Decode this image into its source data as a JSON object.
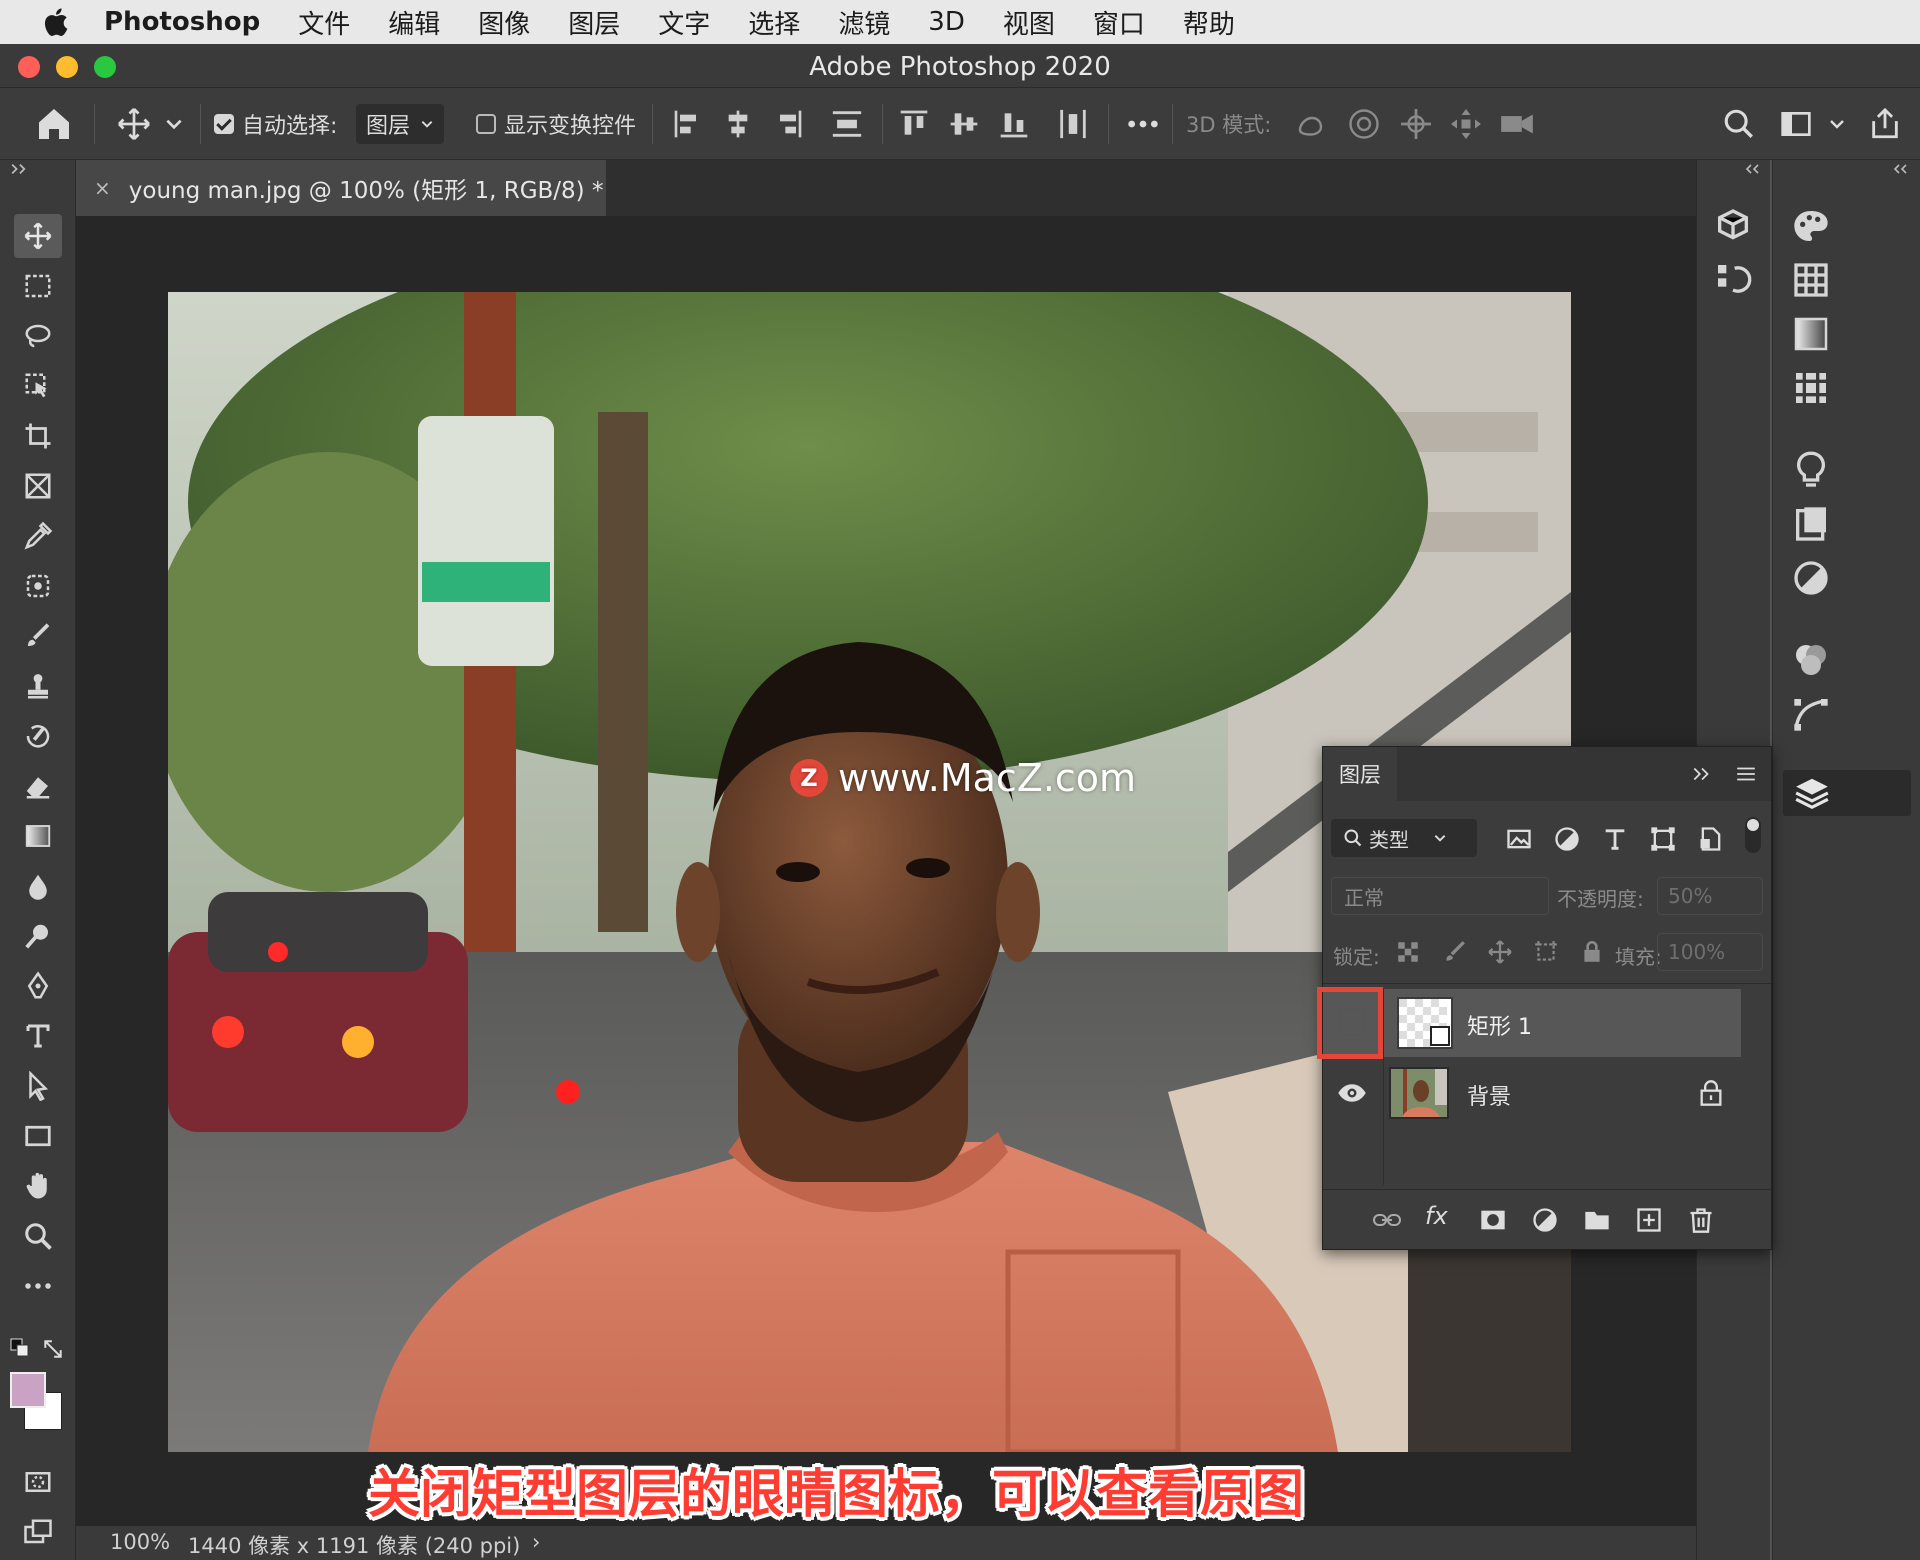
{
  "menubar": {
    "apple_icon": "apple-logo-icon",
    "app_name": "Photoshop",
    "items": [
      "文件",
      "编辑",
      "图像",
      "图层",
      "文字",
      "选择",
      "滤镜",
      "3D",
      "视图",
      "窗口",
      "帮助"
    ]
  },
  "window": {
    "title": "Adobe Photoshop 2020",
    "traffic_lights": {
      "close": "#ff5f57",
      "minimize": "#febc2e",
      "zoom": "#28c840"
    }
  },
  "options_bar": {
    "auto_select_label": "自动选择:",
    "auto_select_checked": true,
    "auto_select_target": "图层",
    "show_transform_label": "显示变换控件",
    "show_transform_checked": false,
    "mode_3d_label": "3D 模式:"
  },
  "document": {
    "tab_close": "×",
    "tab_title": "young man.jpg @ 100% (矩形 1, RGB/8) *",
    "watermark": "www.MacZ.com",
    "watermark_badge": "Z",
    "caption": "关闭矩型图层的眼睛图标，可以查看原图"
  },
  "status": {
    "zoom": "100%",
    "info": "1440 像素 x 1191 像素 (240 ppi)",
    "arrow": "›"
  },
  "colors": {
    "foreground": "#c9a2c4",
    "background": "#ffffff",
    "highlight": "#e4473a"
  },
  "layers_panel": {
    "tab_label": "图层",
    "filter_label": "类型",
    "blend_mode": "正常",
    "opacity_label": "不透明度:",
    "opacity_value": "50%",
    "lock_label": "锁定:",
    "fill_label": "填充:",
    "fill_value": "100%",
    "layers": [
      {
        "name": "矩形 1",
        "visible": false,
        "selected": true,
        "type": "shape"
      },
      {
        "name": "背景",
        "visible": true,
        "selected": false,
        "locked": true,
        "type": "image"
      }
    ],
    "footer_icons": [
      "link-icon",
      "fx-icon",
      "mask-icon",
      "adjustment-icon",
      "folder-icon",
      "new-layer-icon",
      "trash-icon"
    ],
    "fx_label": "fx"
  }
}
